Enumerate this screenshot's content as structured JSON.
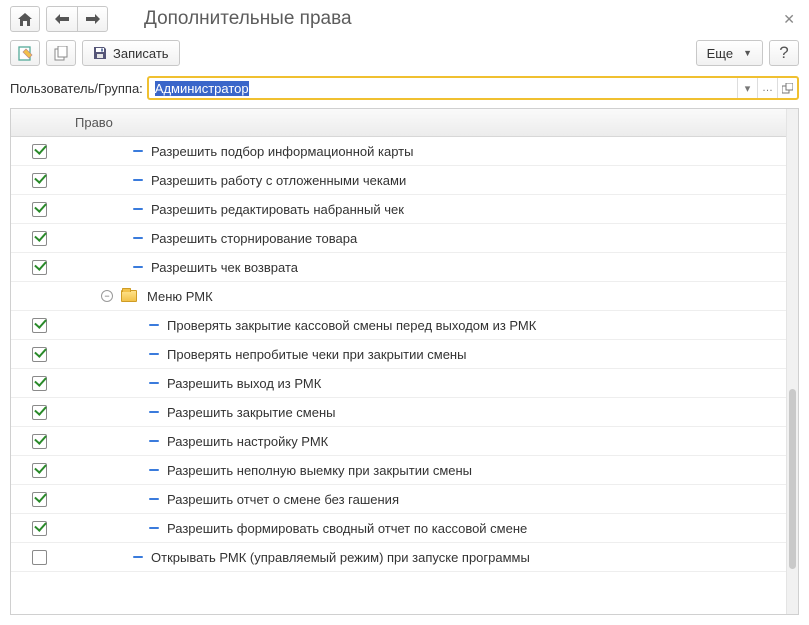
{
  "title": "Дополнительные права",
  "toolbar": {
    "write_label": "Записать",
    "more_label": "Еще"
  },
  "field": {
    "label": "Пользователь/Группа:",
    "value": "Администратор"
  },
  "grid": {
    "column_header": "Право",
    "rows": [
      {
        "type": "item",
        "level": 1,
        "checked": true,
        "label": "Разрешить подбор информационной карты"
      },
      {
        "type": "item",
        "level": 1,
        "checked": true,
        "label": "Разрешить работу с отложенными чеками"
      },
      {
        "type": "item",
        "level": 1,
        "checked": true,
        "label": "Разрешить редактировать набранный чек"
      },
      {
        "type": "item",
        "level": 1,
        "checked": true,
        "label": "Разрешить сторнирование товара"
      },
      {
        "type": "item",
        "level": 1,
        "checked": true,
        "label": "Разрешить чек возврата"
      },
      {
        "type": "group",
        "label": "Меню РМК"
      },
      {
        "type": "item",
        "level": 2,
        "checked": true,
        "label": "Проверять закрытие кассовой смены перед выходом из РМК"
      },
      {
        "type": "item",
        "level": 2,
        "checked": true,
        "label": "Проверять непробитые чеки при закрытии смены"
      },
      {
        "type": "item",
        "level": 2,
        "checked": true,
        "label": "Разрешить выход из РМК"
      },
      {
        "type": "item",
        "level": 2,
        "checked": true,
        "label": "Разрешить закрытие смены"
      },
      {
        "type": "item",
        "level": 2,
        "checked": true,
        "label": "Разрешить настройку РМК"
      },
      {
        "type": "item",
        "level": 2,
        "checked": true,
        "label": "Разрешить неполную выемку при закрытии смены"
      },
      {
        "type": "item",
        "level": 2,
        "checked": true,
        "label": "Разрешить отчет о смене без гашения"
      },
      {
        "type": "item",
        "level": 2,
        "checked": true,
        "label": "Разрешить формировать сводный отчет по кассовой смене"
      },
      {
        "type": "item",
        "level": 1,
        "checked": false,
        "label": "Открывать РМК (управляемый режим) при запуске программы"
      }
    ]
  }
}
